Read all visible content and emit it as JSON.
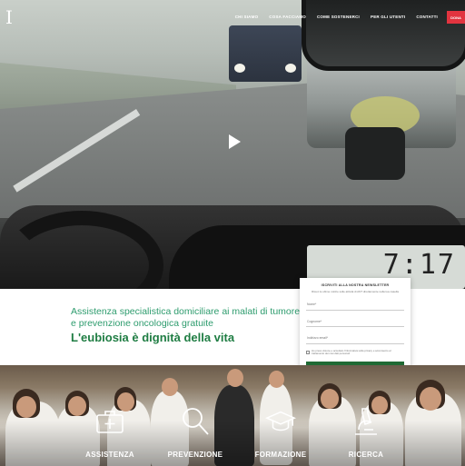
{
  "header": {
    "nav": [
      "CHI SIAMO",
      "COSA FACCIAMO",
      "COME SOSTENERCI",
      "PER GLI UTENTI",
      "CONTATTI"
    ],
    "donate_label": "DONA",
    "logo_glyph": "I"
  },
  "hero": {
    "play_icon": "play-icon",
    "dashboard_display": "7:17"
  },
  "intro": {
    "tagline": "Assistenza specialistica domiciliare ai malati di tumore e prevenzione oncologica gratuite",
    "slogan": "L'eubiosia è dignità della vita"
  },
  "newsletter": {
    "title": "ISCRIVITI ALLA NOSTRA NEWSLETTER",
    "subtitle": "Ricevi le ultime notizie sulle attività di ANT direttamente nella tua casella",
    "name_placeholder": "Nome*",
    "surname_placeholder": "Cognome*",
    "email_placeholder": "Indirizzo email*",
    "privacy_text": "Ho preso visione e accettato l'informativa sulla privacy e acconsento al trattamento dei miei dati personali",
    "submit_label": "ISCRIVITI"
  },
  "categories": [
    {
      "label": "ASSISTENZA",
      "icon": "medical-bag-icon"
    },
    {
      "label": "PREVENZIONE",
      "icon": "magnifier-icon"
    },
    {
      "label": "FORMAZIONE",
      "icon": "graduation-cap-icon"
    },
    {
      "label": "RICERCA",
      "icon": "microscope-icon"
    }
  ],
  "colors": {
    "brand_green": "#1f7d43",
    "tagline_green": "#2e9c6e",
    "donate_red": "#e2343f",
    "button_green": "#1f6a34"
  }
}
